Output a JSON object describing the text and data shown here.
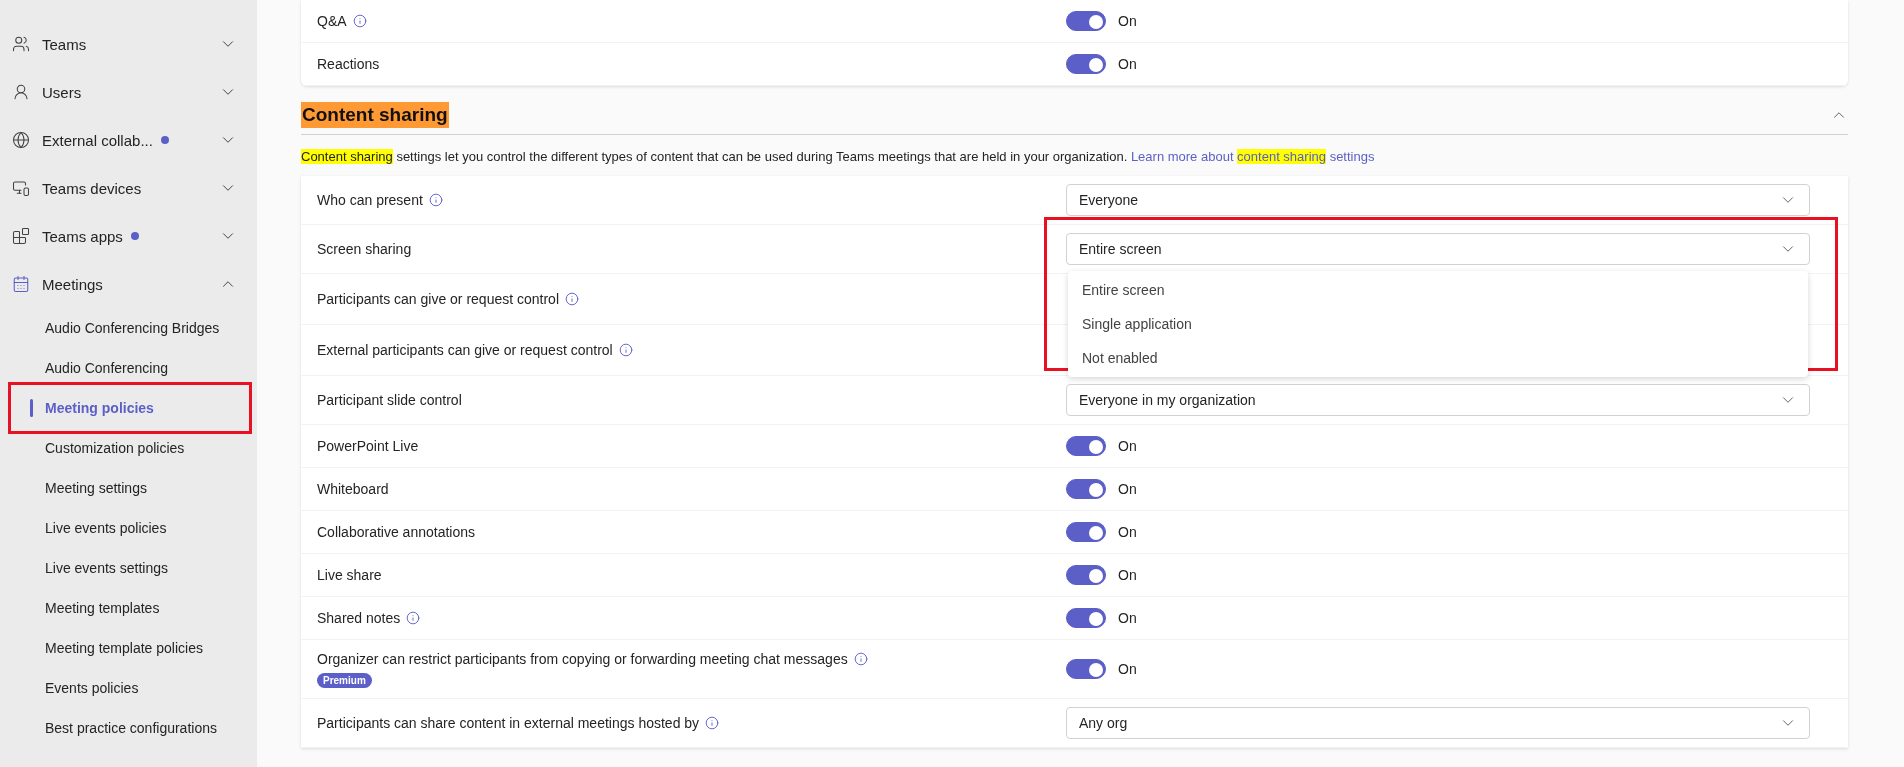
{
  "sidebar": {
    "items": [
      {
        "label": "Teams",
        "expanded": false
      },
      {
        "label": "Users",
        "expanded": false
      },
      {
        "label": "External collab...",
        "dot": true,
        "expanded": false
      },
      {
        "label": "Teams devices",
        "expanded": false
      },
      {
        "label": "Teams apps",
        "dot": true,
        "expanded": false
      },
      {
        "label": "Meetings",
        "expanded": true,
        "children": [
          {
            "label": "Audio Conferencing Bridges",
            "selected": false
          },
          {
            "label": "Audio Conferencing",
            "selected": false
          },
          {
            "label": "Meeting policies",
            "selected": true,
            "boxed": true
          },
          {
            "label": "Customization policies",
            "selected": false
          },
          {
            "label": "Meeting settings",
            "selected": false
          },
          {
            "label": "Live events policies",
            "selected": false
          },
          {
            "label": "Live events settings",
            "selected": false
          },
          {
            "label": "Meeting templates",
            "selected": false
          },
          {
            "label": "Meeting template policies",
            "selected": false
          },
          {
            "label": "Events policies",
            "selected": false
          },
          {
            "label": "Best practice configurations",
            "selected": false
          }
        ]
      }
    ]
  },
  "previous_settings": [
    {
      "kind": "toggle",
      "label": "Q&A",
      "info": true,
      "on": true,
      "state_label": "On"
    },
    {
      "kind": "toggle",
      "label": "Reactions",
      "on": true,
      "state_label": "On"
    }
  ],
  "section": {
    "title": "Content sharing",
    "expanded": true,
    "description": {
      "parts": [
        {
          "text": "Content sharing",
          "highlight": true
        },
        {
          "text": " settings let you control the different types of content that can be used during Teams meetings that are held in your organization. ",
          "highlight": false
        }
      ],
      "link": [
        {
          "text": "Learn more about ",
          "highlight": false
        },
        {
          "text": "content sharing",
          "highlight": true
        },
        {
          "text": " settings",
          "highlight": false
        }
      ]
    },
    "settings": [
      {
        "kind": "select",
        "label": "Who can present",
        "info": true,
        "value": "Everyone"
      },
      {
        "kind": "select",
        "label": "Screen sharing",
        "value": "Entire screen",
        "open": true,
        "boxed": true,
        "options": [
          "Entire screen",
          "Single application",
          "Not enabled"
        ]
      },
      {
        "kind": "hidden",
        "label": "Participants can give or request control",
        "info": true
      },
      {
        "kind": "hidden",
        "label": "External participants can give or request control",
        "info": true
      },
      {
        "kind": "select",
        "label": "Participant slide control",
        "value": "Everyone in my organization"
      },
      {
        "kind": "toggle",
        "label": "PowerPoint Live",
        "on": true,
        "state_label": "On"
      },
      {
        "kind": "toggle",
        "label": "Whiteboard",
        "on": true,
        "state_label": "On"
      },
      {
        "kind": "toggle",
        "label": "Collaborative annotations",
        "on": true,
        "state_label": "On"
      },
      {
        "kind": "toggle",
        "label": "Live share",
        "on": true,
        "state_label": "On"
      },
      {
        "kind": "toggle",
        "label": "Shared notes",
        "info": true,
        "on": true,
        "state_label": "On"
      },
      {
        "kind": "toggle",
        "label": "Organizer can restrict participants from copying or forwarding meeting chat messages",
        "info": true,
        "badge": "Premium",
        "on": true,
        "state_label": "On"
      },
      {
        "kind": "select",
        "label": "Participants can share content in external meetings hosted by",
        "info": true,
        "value": "Any org"
      }
    ]
  }
}
